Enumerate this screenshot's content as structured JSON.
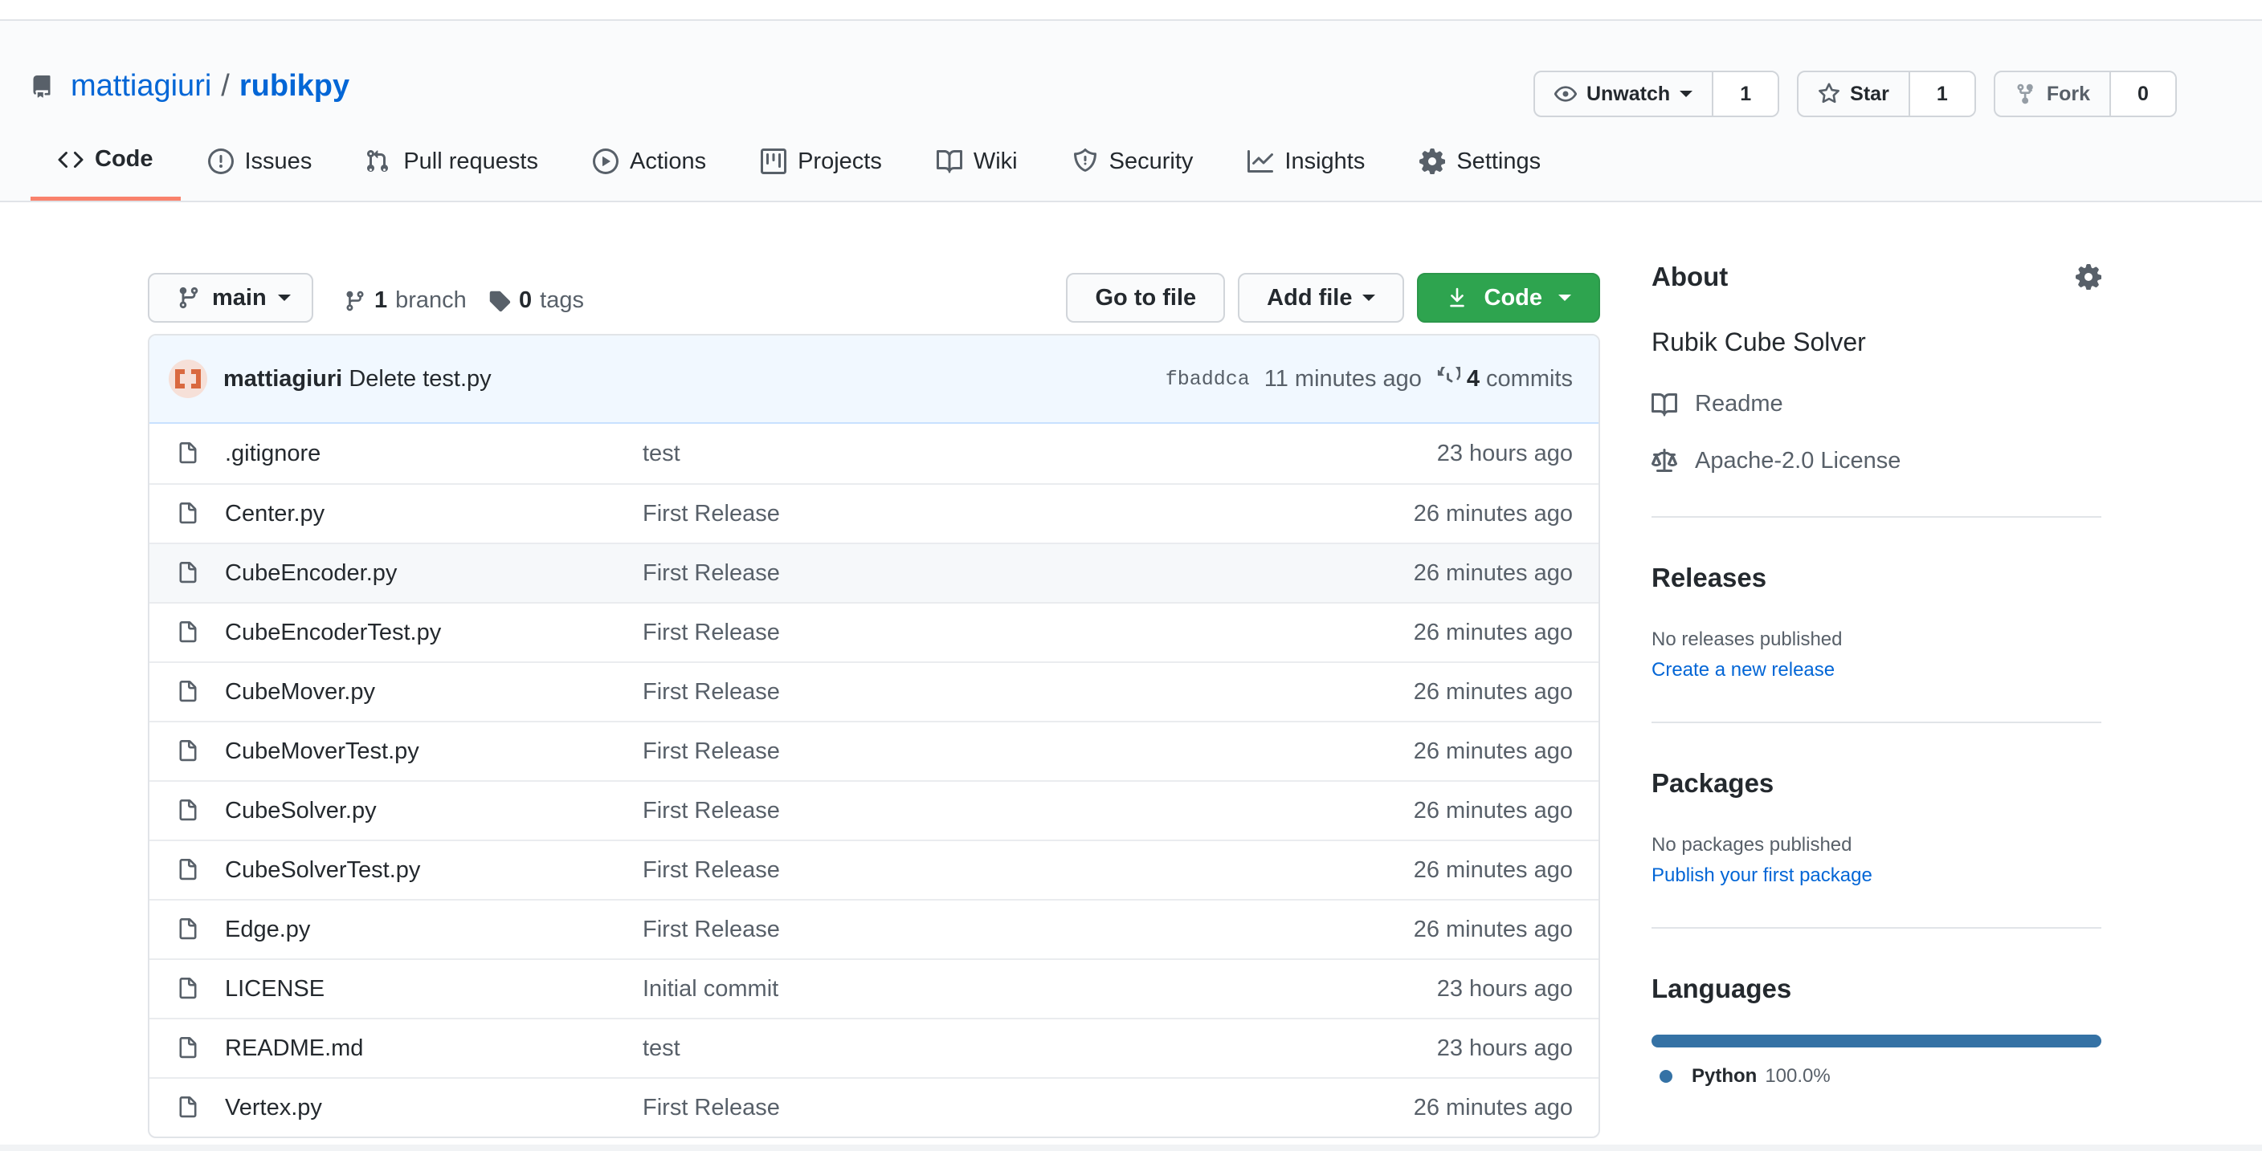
{
  "repo": {
    "owner": "mattiagiuri",
    "separator": "/",
    "name": "rubikpy"
  },
  "actions": {
    "watch": {
      "label": "Unwatch",
      "count": "1"
    },
    "star": {
      "label": "Star",
      "count": "1"
    },
    "fork": {
      "label": "Fork",
      "count": "0"
    }
  },
  "tabs": [
    {
      "label": "Code",
      "icon": "code-icon"
    },
    {
      "label": "Issues",
      "icon": "issue-icon"
    },
    {
      "label": "Pull requests",
      "icon": "pull-request-icon"
    },
    {
      "label": "Actions",
      "icon": "play-icon"
    },
    {
      "label": "Projects",
      "icon": "project-icon"
    },
    {
      "label": "Wiki",
      "icon": "book-icon"
    },
    {
      "label": "Security",
      "icon": "shield-icon"
    },
    {
      "label": "Insights",
      "icon": "graph-icon"
    },
    {
      "label": "Settings",
      "icon": "gear-icon"
    }
  ],
  "filebar": {
    "branch": "main",
    "branch_count": "1",
    "branch_label": "branch",
    "tag_count": "0",
    "tag_label": "tags",
    "go_to_file": "Go to file",
    "add_file": "Add file",
    "code": "Code"
  },
  "commit": {
    "author": "mattiagiuri",
    "message": "Delete test.py",
    "sha": "fbaddca",
    "time": "11 minutes ago",
    "count": "4",
    "count_label": "commits"
  },
  "files": [
    {
      "name": ".gitignore",
      "message": "test",
      "time": "23 hours ago"
    },
    {
      "name": "Center.py",
      "message": "First Release",
      "time": "26 minutes ago"
    },
    {
      "name": "CubeEncoder.py",
      "message": "First Release",
      "time": "26 minutes ago"
    },
    {
      "name": "CubeEncoderTest.py",
      "message": "First Release",
      "time": "26 minutes ago"
    },
    {
      "name": "CubeMover.py",
      "message": "First Release",
      "time": "26 minutes ago"
    },
    {
      "name": "CubeMoverTest.py",
      "message": "First Release",
      "time": "26 minutes ago"
    },
    {
      "name": "CubeSolver.py",
      "message": "First Release",
      "time": "26 minutes ago"
    },
    {
      "name": "CubeSolverTest.py",
      "message": "First Release",
      "time": "26 minutes ago"
    },
    {
      "name": "Edge.py",
      "message": "First Release",
      "time": "26 minutes ago"
    },
    {
      "name": "LICENSE",
      "message": "Initial commit",
      "time": "23 hours ago"
    },
    {
      "name": "README.md",
      "message": "test",
      "time": "23 hours ago"
    },
    {
      "name": "Vertex.py",
      "message": "First Release",
      "time": "26 minutes ago"
    }
  ],
  "sidebar": {
    "about_title": "About",
    "description": "Rubik Cube Solver",
    "readme": "Readme",
    "license": "Apache-2.0 License",
    "releases_title": "Releases",
    "releases_none": "No releases published",
    "releases_link": "Create a new release",
    "packages_title": "Packages",
    "packages_none": "No packages published",
    "packages_link": "Publish your first package",
    "languages_title": "Languages",
    "language_name": "Python",
    "language_pct": "100.0%",
    "language_color": "#3572A5"
  }
}
